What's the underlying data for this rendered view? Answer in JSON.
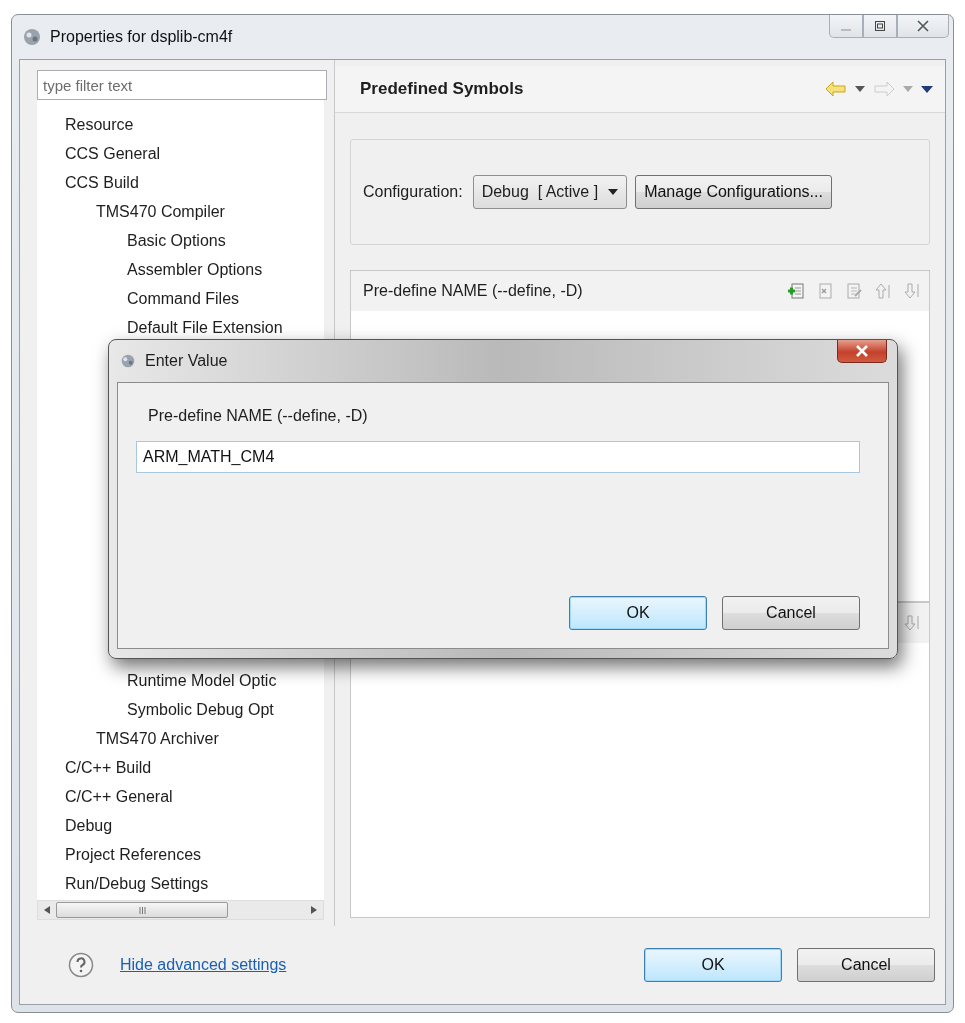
{
  "window": {
    "title": "Properties for dsplib-cm4f"
  },
  "filter": {
    "placeholder": "type filter text"
  },
  "tree": [
    {
      "label": "Resource"
    },
    {
      "label": "CCS General"
    },
    {
      "label": "CCS Build",
      "children": [
        {
          "label": "TMS470 Compiler",
          "children": [
            {
              "label": "Basic Options"
            },
            {
              "label": "Assembler Options"
            },
            {
              "label": "Command Files"
            },
            {
              "label": "Default File Extension"
            },
            {
              "label": "Runtime Model Optic"
            },
            {
              "label": "Symbolic Debug Opt"
            }
          ]
        },
        {
          "label": "TMS470 Archiver"
        }
      ]
    },
    {
      "label": "C/C++ Build"
    },
    {
      "label": "C/C++ General"
    },
    {
      "label": "Debug"
    },
    {
      "label": "Project References"
    },
    {
      "label": "Run/Debug Settings"
    }
  ],
  "page": {
    "title": "Predefined Symbols",
    "configuration": {
      "label": "Configuration:",
      "value": "Debug  [ Active ]",
      "button": "Manage Configurations..."
    },
    "define_list": {
      "header": "Pre-define NAME (--define, -D)"
    }
  },
  "footer": {
    "link": "Hide advanced settings",
    "buttons": [
      {
        "label": "OK",
        "default": true
      },
      {
        "label": "Cancel",
        "default": false
      }
    ]
  },
  "dialog": {
    "title": "Enter Value",
    "label": "Pre-define NAME (--define, -D)",
    "value": "ARM_MATH_CM4",
    "buttons": [
      {
        "label": "OK",
        "default": true
      },
      {
        "label": "Cancel",
        "default": false
      }
    ]
  }
}
